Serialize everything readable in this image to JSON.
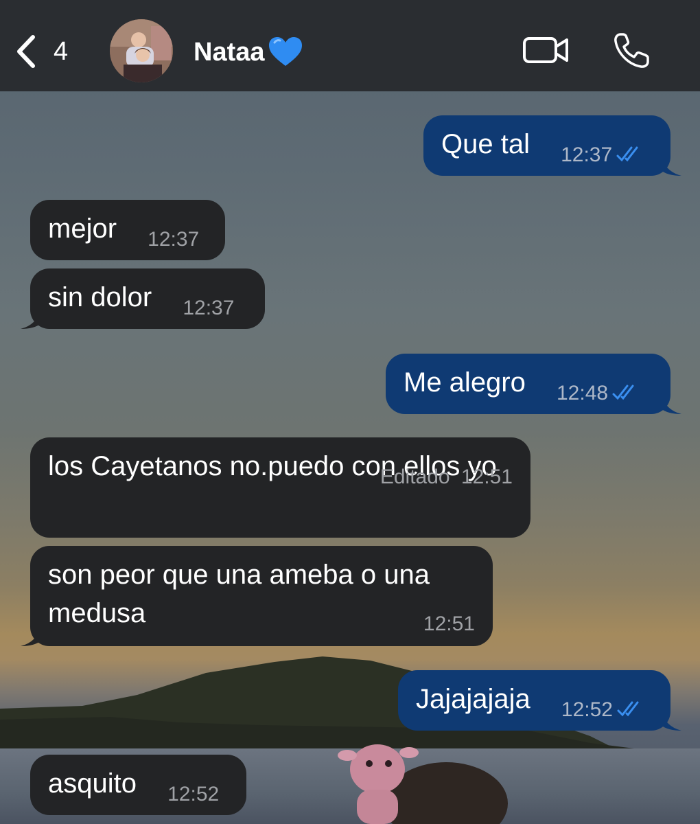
{
  "header": {
    "back_count": "4",
    "contact_name": "Nataa",
    "contact_emoji": "💙"
  },
  "icons": {
    "back": "chevron-left-icon",
    "video": "video-camera-icon",
    "call": "phone-icon",
    "read_receipt": "double-check-icon"
  },
  "colors": {
    "header_bg": "#2a2d31",
    "incoming_bubble": "#232426",
    "outgoing_bubble": "#0f3a73",
    "read_ticks": "#3a8ff0"
  },
  "messages": [
    {
      "direction": "out",
      "text": "Que tal",
      "time": "12:37",
      "read": true
    },
    {
      "direction": "in",
      "text": "mejor",
      "time": "12:37"
    },
    {
      "direction": "in",
      "text": "sin dolor",
      "time": "12:37"
    },
    {
      "direction": "out",
      "text": "Me alegro",
      "time": "12:48",
      "read": true
    },
    {
      "direction": "in",
      "text": "los Cayetanos no.puedo con ellos yo",
      "time": "12:51",
      "edited_label": "Editado"
    },
    {
      "direction": "in",
      "text": "son peor que una ameba o una medusa",
      "time": "12:51"
    },
    {
      "direction": "out",
      "text": "Jajajajaja",
      "time": "12:52",
      "read": true
    },
    {
      "direction": "in",
      "text": "asquito",
      "time": "12:52"
    }
  ]
}
